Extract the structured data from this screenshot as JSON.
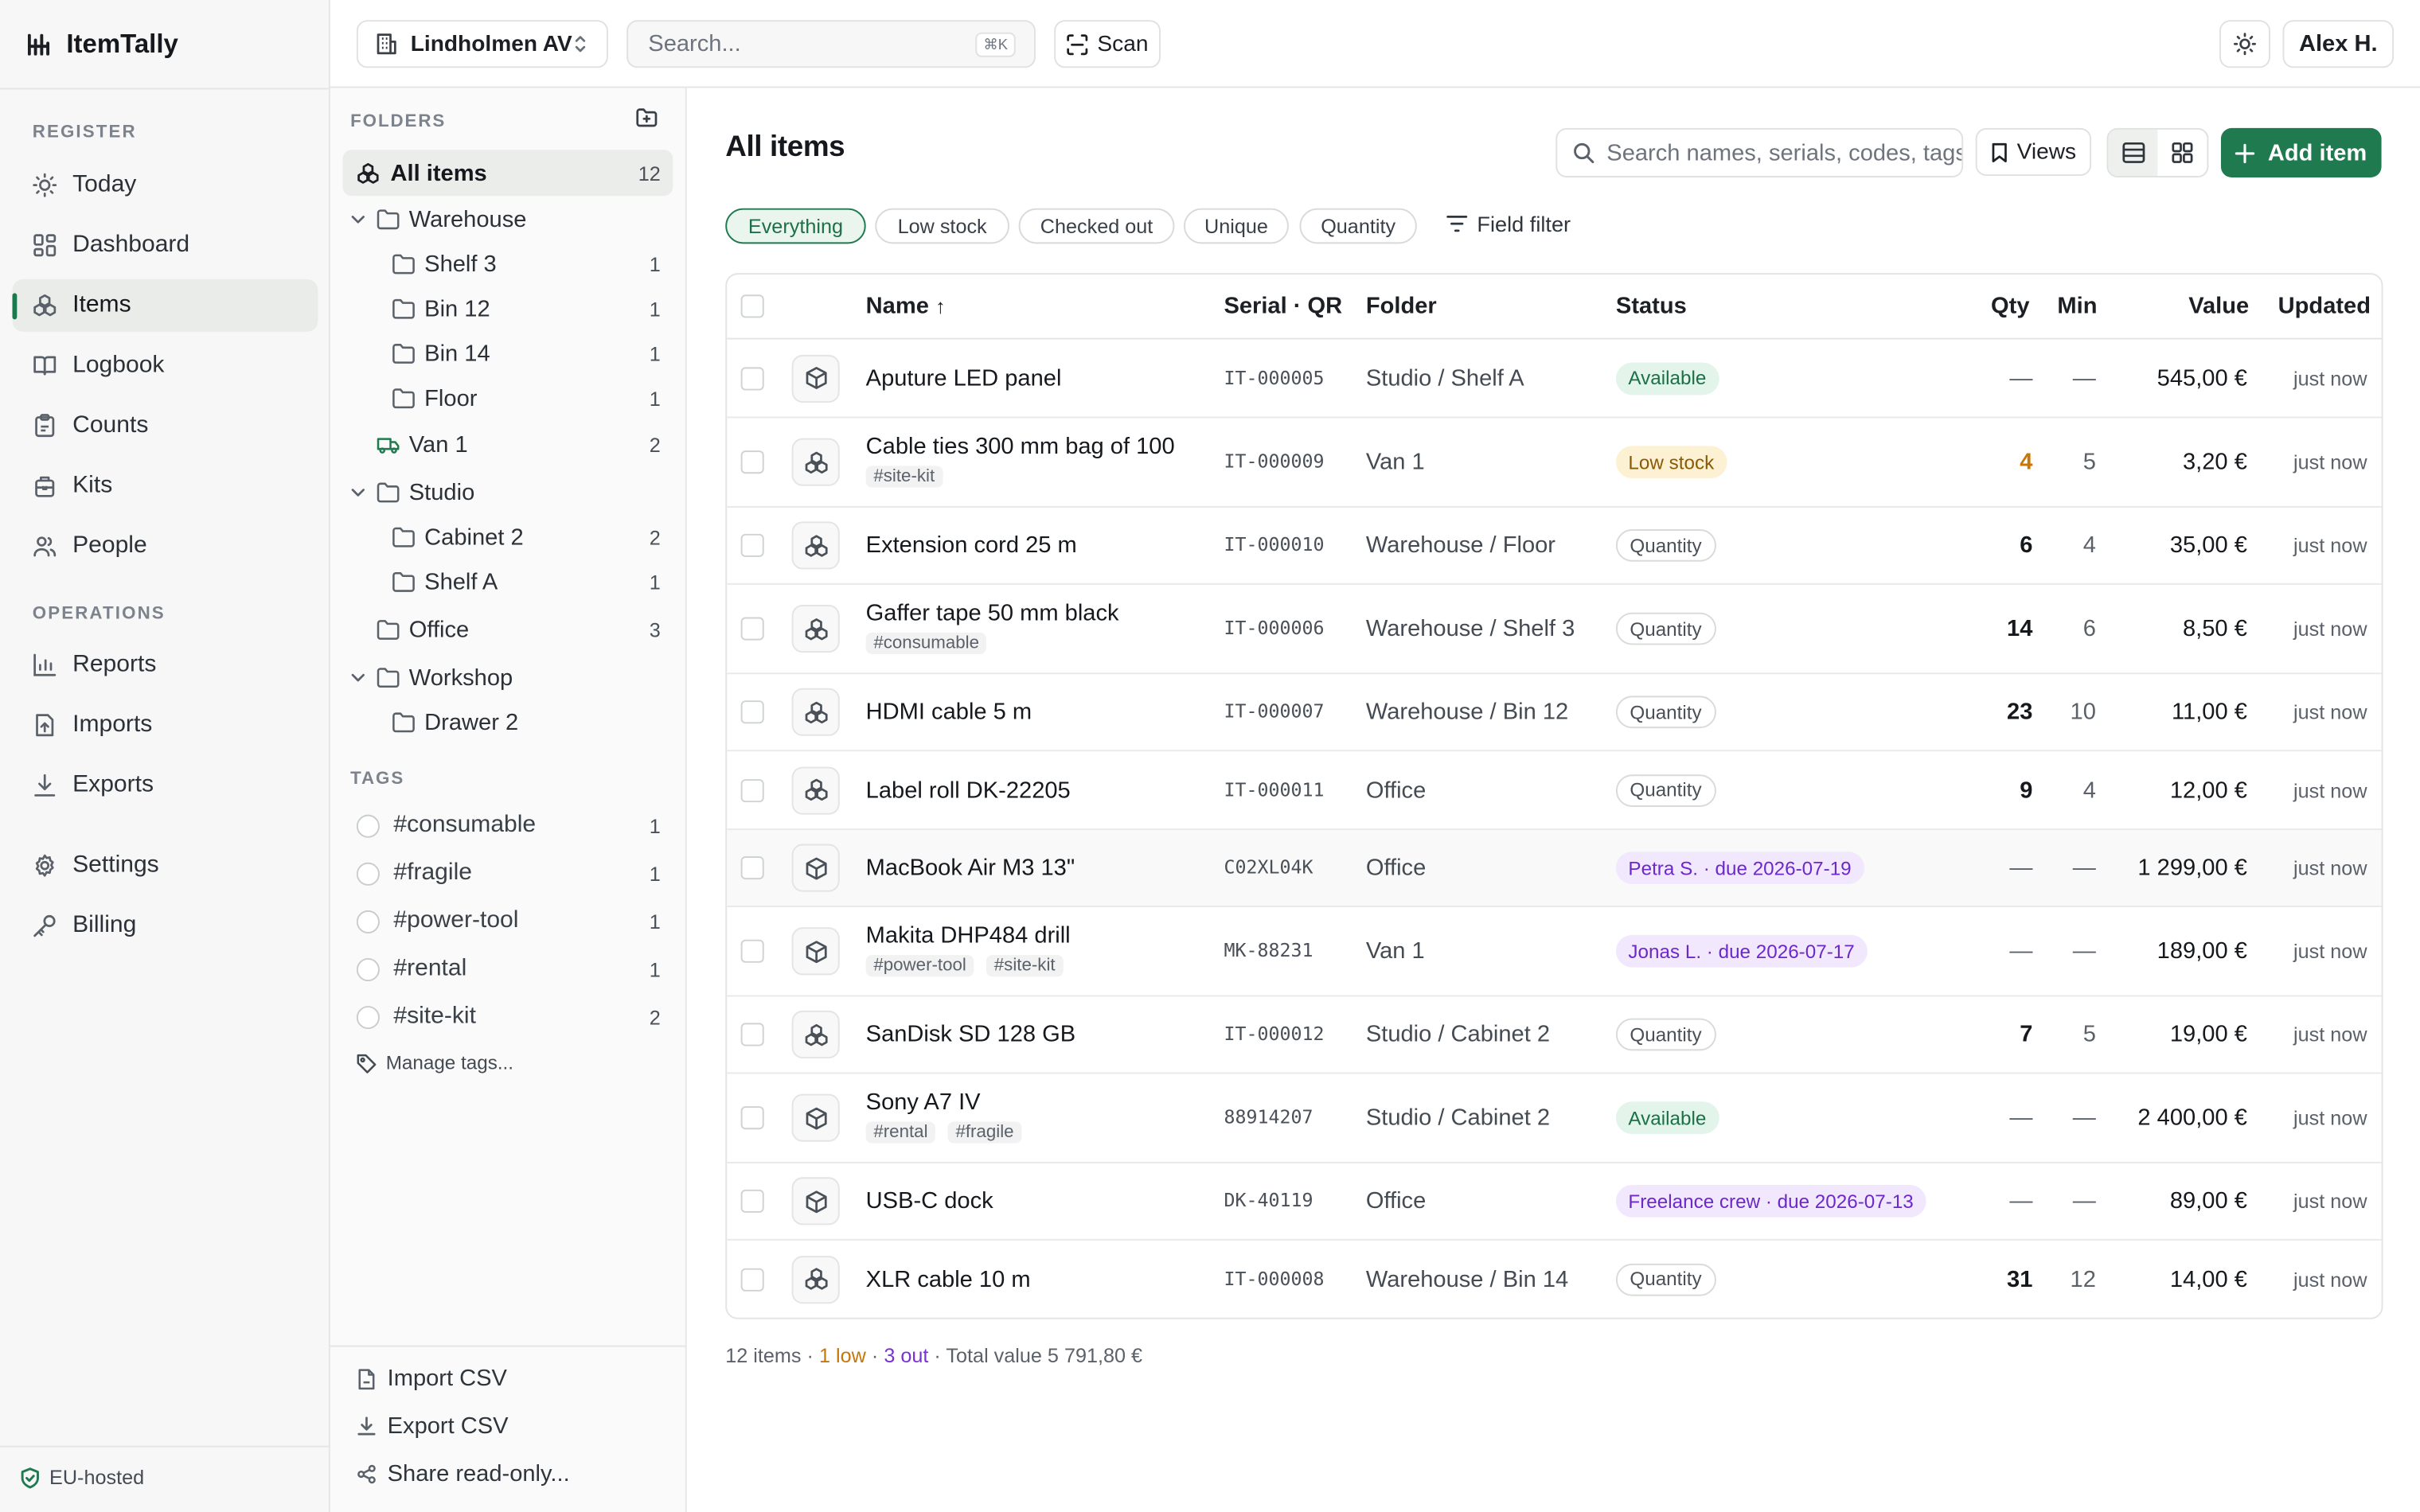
{
  "app": {
    "name": "ItemTally",
    "hosting": "EU-hosted"
  },
  "sidebar": {
    "register_label": "REGISTER",
    "register_items": [
      {
        "label": "Today",
        "icon": "sun-icon"
      },
      {
        "label": "Dashboard",
        "icon": "dashboard-icon"
      },
      {
        "label": "Items",
        "icon": "items-icon",
        "active": true
      },
      {
        "label": "Logbook",
        "icon": "book-icon"
      },
      {
        "label": "Counts",
        "icon": "clipboard-icon"
      },
      {
        "label": "Kits",
        "icon": "kit-icon"
      },
      {
        "label": "People",
        "icon": "people-icon"
      }
    ],
    "operations_label": "OPERATIONS",
    "operations_items": [
      {
        "label": "Reports",
        "icon": "chart-icon"
      },
      {
        "label": "Imports",
        "icon": "import-icon"
      },
      {
        "label": "Exports",
        "icon": "export-icon"
      }
    ],
    "bottom_items": [
      {
        "label": "Settings",
        "icon": "gear-icon"
      },
      {
        "label": "Billing",
        "icon": "key-icon"
      }
    ]
  },
  "topbar": {
    "workspace": "Lindholmen AV",
    "search_placeholder": "Search...",
    "search_shortcut": "⌘K",
    "scan_label": "Scan",
    "user": "Alex H."
  },
  "folders_panel": {
    "label": "FOLDERS",
    "all_items": {
      "label": "All items",
      "count": "12"
    },
    "tree": [
      {
        "label": "Warehouse",
        "count": "",
        "level": 0,
        "expandable": true
      },
      {
        "label": "Shelf 3",
        "count": "1",
        "level": 1
      },
      {
        "label": "Bin 12",
        "count": "1",
        "level": 1
      },
      {
        "label": "Bin 14",
        "count": "1",
        "level": 1
      },
      {
        "label": "Floor",
        "count": "1",
        "level": 1
      },
      {
        "label": "Van 1",
        "count": "2",
        "level": 0,
        "van": true
      },
      {
        "label": "Studio",
        "count": "",
        "level": 0,
        "expandable": true
      },
      {
        "label": "Cabinet 2",
        "count": "2",
        "level": 1
      },
      {
        "label": "Shelf A",
        "count": "1",
        "level": 1
      },
      {
        "label": "Office",
        "count": "3",
        "level": 0
      },
      {
        "label": "Workshop",
        "count": "",
        "level": 0,
        "expandable": true
      },
      {
        "label": "Drawer 2",
        "count": "",
        "level": 1
      }
    ],
    "tags_label": "TAGS",
    "tags": [
      {
        "label": "#consumable",
        "count": "1"
      },
      {
        "label": "#fragile",
        "count": "1"
      },
      {
        "label": "#power-tool",
        "count": "1"
      },
      {
        "label": "#rental",
        "count": "1"
      },
      {
        "label": "#site-kit",
        "count": "2"
      }
    ],
    "manage_tags": "Manage tags...",
    "import_csv": "Import CSV",
    "export_csv": "Export CSV",
    "share": "Share read-only..."
  },
  "main": {
    "title": "All items",
    "search_placeholder": "Search names, serials, codes, tags",
    "views_label": "Views",
    "add_label": "Add item",
    "filters": [
      {
        "label": "Everything",
        "active": true
      },
      {
        "label": "Low stock"
      },
      {
        "label": "Checked out"
      },
      {
        "label": "Unique"
      },
      {
        "label": "Quantity"
      }
    ],
    "field_filter": "Field filter",
    "columns": {
      "name": "Name",
      "sort_arrow": "↑",
      "serial": "Serial · QR",
      "folder": "Folder",
      "status": "Status",
      "qty": "Qty",
      "min": "Min",
      "value": "Value",
      "updated": "Updated"
    },
    "rows": [
      {
        "name": "Aputure LED panel",
        "tags": [],
        "kind": "unique",
        "serial": "IT-000005",
        "folder": "Studio / Shelf A",
        "status": "Available",
        "status_type": "available",
        "qty": "—",
        "min": "—",
        "value": "545,00 €",
        "updated": "just now"
      },
      {
        "name": "Cable ties 300 mm bag of 100",
        "tags": [
          "#site-kit"
        ],
        "kind": "quantity",
        "serial": "IT-000009",
        "folder": "Van 1",
        "status": "Low stock",
        "status_type": "low",
        "qty": "4",
        "min": "5",
        "value": "3,20 €",
        "updated": "just now"
      },
      {
        "name": "Extension cord 25 m",
        "tags": [],
        "kind": "quantity",
        "serial": "IT-000010",
        "folder": "Warehouse / Floor",
        "status": "Quantity",
        "status_type": "qty",
        "qty": "6",
        "min": "4",
        "value": "35,00 €",
        "updated": "just now"
      },
      {
        "name": "Gaffer tape 50 mm black",
        "tags": [
          "#consumable"
        ],
        "kind": "quantity",
        "serial": "IT-000006",
        "folder": "Warehouse / Shelf 3",
        "status": "Quantity",
        "status_type": "qty",
        "qty": "14",
        "min": "6",
        "value": "8,50 €",
        "updated": "just now"
      },
      {
        "name": "HDMI cable 5 m",
        "tags": [],
        "kind": "quantity",
        "serial": "IT-000007",
        "folder": "Warehouse / Bin 12",
        "status": "Quantity",
        "status_type": "qty",
        "qty": "23",
        "min": "10",
        "value": "11,00 €",
        "updated": "just now"
      },
      {
        "name": "Label roll DK-22205",
        "tags": [],
        "kind": "quantity",
        "serial": "IT-000011",
        "folder": "Office",
        "status": "Quantity",
        "status_type": "qty",
        "qty": "9",
        "min": "4",
        "value": "12,00 €",
        "updated": "just now"
      },
      {
        "name": "MacBook Air M3 13\"",
        "tags": [],
        "kind": "unique",
        "serial": "C02XL04K",
        "folder": "Office",
        "status": "Petra S. · due 2026-07-19",
        "status_type": "out",
        "qty": "—",
        "min": "—",
        "value": "1 299,00 €",
        "updated": "just now"
      },
      {
        "name": "Makita DHP484 drill",
        "tags": [
          "#power-tool",
          "#site-kit"
        ],
        "kind": "unique",
        "serial": "MK-88231",
        "folder": "Van 1",
        "status": "Jonas L. · due 2026-07-17",
        "status_type": "out",
        "qty": "—",
        "min": "—",
        "value": "189,00 €",
        "updated": "just now"
      },
      {
        "name": "SanDisk SD 128 GB",
        "tags": [],
        "kind": "quantity",
        "serial": "IT-000012",
        "folder": "Studio / Cabinet 2",
        "status": "Quantity",
        "status_type": "qty",
        "qty": "7",
        "min": "5",
        "value": "19,00 €",
        "updated": "just now"
      },
      {
        "name": "Sony A7 IV",
        "tags": [
          "#rental",
          "#fragile"
        ],
        "kind": "unique",
        "serial": "88914207",
        "folder": "Studio / Cabinet 2",
        "status": "Available",
        "status_type": "available",
        "qty": "—",
        "min": "—",
        "value": "2 400,00 €",
        "updated": "just now"
      },
      {
        "name": "USB-C dock",
        "tags": [],
        "kind": "unique",
        "serial": "DK-40119",
        "folder": "Office",
        "status": "Freelance crew · due 2026-07-13",
        "status_type": "out",
        "qty": "—",
        "min": "—",
        "value": "89,00 €",
        "updated": "just now"
      },
      {
        "name": "XLR cable 10 m",
        "tags": [],
        "kind": "quantity",
        "serial": "IT-000008",
        "folder": "Warehouse / Bin 14",
        "status": "Quantity",
        "status_type": "qty",
        "qty": "31",
        "min": "12",
        "value": "14,00 €",
        "updated": "just now"
      }
    ],
    "summary": {
      "items": "12 items",
      "low": "1 low",
      "out": "3 out",
      "total": "Total value 5 791,80 €"
    }
  },
  "colors": {
    "accent": "#1f7a4f",
    "warning": "#c7770a",
    "checked_out": "#7a32d4",
    "available": "#1d6f47"
  }
}
